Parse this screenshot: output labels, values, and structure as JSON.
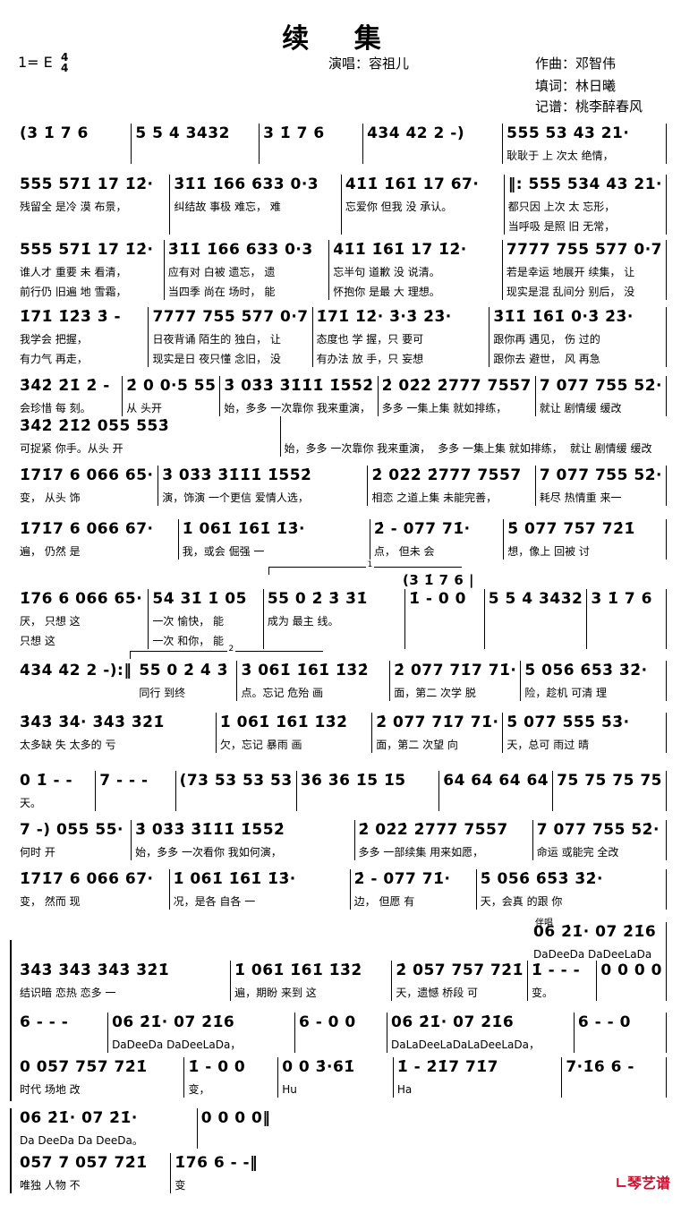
{
  "header": {
    "title": "续  集",
    "key": "1= E",
    "time_signature": {
      "top": "4",
      "bottom": "4"
    },
    "singer": "演唱：容祖儿",
    "composer": "作曲：邓智伟",
    "lyricist": "填词：林日曦",
    "transcriber": "记谱：桃李醉春风"
  },
  "volta_labels": [
    "1",
    "2"
  ],
  "accompaniment_label": "伴唱",
  "logo_text": "琴艺谱",
  "logo_color": "#c8102e",
  "systems": [
    {
      "measures": [
        {
          "notes": "(3 1̇ 7 6",
          "lyrics": []
        },
        {
          "notes": "5 5 4 3432",
          "lyrics": []
        },
        {
          "notes": "3 1̇ 7 6",
          "lyrics": []
        },
        {
          "notes": "434 42 2 -)",
          "lyrics": []
        },
        {
          "notes": "555 53 43 21·",
          "lyrics": [
            "耿耿于 上 次太 绝情，"
          ]
        }
      ]
    },
    {
      "measures": [
        {
          "notes": "555 571̇ 17 1̇2̇·",
          "lyrics": [
            "残留全 是冷 漠 布景，"
          ]
        },
        {
          "notes": "3̇1̇1̇ 1̇66 633 0·3",
          "lyrics": [
            "纠结故 事极 难忘， 难"
          ]
        },
        {
          "notes": "41̇1̇ 1̇61̇ 17 67·",
          "lyrics": [
            "忘爱你 但我 没 承认。"
          ]
        },
        {
          "notes": "‖: 555 534 43 21·",
          "lyrics": [
            "都只因 上次 太 忘形，",
            "当呼吸 是照 旧 无常，"
          ]
        }
      ]
    },
    {
      "measures": [
        {
          "notes": "555 571̇ 17 1̇2̇·",
          "lyrics": [
            "谁人才 重要 未 看清，",
            "前行仍 旧遍 地 雪霜，"
          ]
        },
        {
          "notes": "3̇1̇1̇ 1̇66 633 0·3",
          "lyrics": [
            "应有对 白被 遗忘， 遗",
            "当四季 尚在 场时， 能"
          ]
        },
        {
          "notes": "41̇1̇ 1̇61̇ 17 1̇2̇·",
          "lyrics": [
            "忘半句 道歉 没 说清。",
            "怀抱你 是最 大 理想。"
          ]
        },
        {
          "notes": "7777 755 577 0·7",
          "lyrics": [
            "若是幸运 地展开 续集， 让",
            "现实是混 乱间分 别后， 没"
          ]
        }
      ]
    },
    {
      "measures": [
        {
          "notes": "1̇71̇ 1̇2̇3̇ 3̇ -",
          "lyrics": [
            "我学会 把握，",
            "有力气 再走，"
          ]
        },
        {
          "notes": "7777 755 577 0·7",
          "lyrics": [
            "日夜背诵 陌生的 独白， 让",
            "现实是日 夜只懂 念旧， 没"
          ]
        },
        {
          "notes": "1̇71̇ 1̇2̇· 3̇·3̇ 2̇3̇·",
          "lyrics": [
            "态度也 学 握，只 要可",
            "有办法 放 手，只 妄想"
          ]
        },
        {
          "notes": "3̇1̇1̇ 1̇61̇ 0·3̇ 2̇3̇·",
          "lyrics": [
            "跟你再 遇见， 伤 过的",
            "跟你去 避世， 风 再急"
          ]
        }
      ]
    },
    {
      "measures": [
        {
          "notes": "3̇4̇2̇ 2̇1̇ 2̇ -",
          "lyrics": [
            "会珍惜 每 刻。"
          ]
        },
        {
          "notes": "2̇ 0 0·5 55",
          "lyrics": [
            "从 头开"
          ]
        },
        {
          "notes": "3̇ 03̇3̇ 3̇1̇1̇1̇ 1̇552̇",
          "lyrics": [
            "始，多多 一次靠你 我来重演，"
          ]
        },
        {
          "notes": "2̇ 02̇2̇ 2̇777 7557",
          "lyrics": [
            "多多 一集上集 就如排练，"
          ]
        },
        {
          "notes": "7 077 755 52̇·",
          "lyrics": [
            "就让 剧情缓 缓改"
          ]
        }
      ]
    },
    {
      "measures": [
        {
          "notes": "3̇4̇2̇ 2̇1̇2̇ 055 553̇",
          "lyrics": [
            "可捉紧 你手。从头 开"
          ]
        },
        {
          "notes": "",
          "lyrics": [
            "始，多多 一次靠你 我来重演，"
          ]
        },
        {
          "notes": "",
          "lyrics": [
            "多多 一集上集 就如排练，"
          ]
        },
        {
          "notes": "",
          "lyrics": [
            "就让 剧情缓 缓改"
          ]
        }
      ]
    },
    {
      "measures": [
        {
          "notes": "1̇71̇7 6 066 65·",
          "lyrics": [
            "变， 从头 饰"
          ]
        },
        {
          "notes": "3̇ 03̇3̇ 3̇1̇1̇1̇ 1̇552̇",
          "lyrics": [
            "演，饰演 一个更信 爱情人选，"
          ]
        },
        {
          "notes": "2̇ 02̇2̇ 2̇777 7557",
          "lyrics": [
            "相恋 之道上集 未能完善，"
          ]
        },
        {
          "notes": "7 077 755 52̇·",
          "lyrics": [
            "耗尽 热情重 来一"
          ]
        }
      ]
    },
    {
      "measures": [
        {
          "notes": "1̇71̇7 6 066 67·",
          "lyrics": [
            "遍， 仍然 是"
          ]
        },
        {
          "notes": "1̇ 061̇ 1̇61̇ 1̇3̇·",
          "lyrics": [
            "我，或会 倔强 一"
          ]
        },
        {
          "notes": "2̇ - 077 71̇·",
          "lyrics": [
            "点， 但未 会"
          ]
        },
        {
          "notes": "5̇ 077 757 72̇1̇",
          "lyrics": [
            "想，像上 回被 讨"
          ]
        }
      ]
    },
    {
      "measures": [
        {
          "notes": "1̇76 6 066 65·",
          "lyrics": [
            "厌， 只想 这",
            "  只想 这"
          ]
        },
        {
          "notes": "54 31̇ 1̇ 05",
          "lyrics": [
            "一次 愉快， 能",
            "一次 和你， 能"
          ]
        },
        {
          "notes": "55 0 2̇ 3̇ 3̇1̇",
          "lyrics": [
            "成为 最主 线。"
          ]
        },
        {
          "notes": "1̇ - 0 0",
          "lyrics": []
        },
        {
          "notes": "5 5 4 3432",
          "lyrics": []
        },
        {
          "notes": "3 1̇ 7 6",
          "lyrics": []
        }
      ]
    },
    {
      "measures": [
        {
          "notes": "434 42 2 -):‖",
          "lyrics": []
        },
        {
          "notes": "55 0 2̇ 4̇ 3̇",
          "lyrics": [
            "同行 到终"
          ]
        },
        {
          "notes": "3̇ 061̇ 1̇61̇ 1̇3̇2̇",
          "lyrics": [
            "点。忘记 危殆 画"
          ]
        },
        {
          "notes": "2̇ 077 71̇7 71̇·",
          "lyrics": [
            "面，第二 次学 脱"
          ]
        },
        {
          "notes": "5̇ 056̇ 6̇53̇ 3̇2̇·",
          "lyrics": [
            "险，趁机 可清 理"
          ]
        }
      ]
    },
    {
      "measures": [
        {
          "notes": "3̇4̇3̇ 3̇4̇· 3̇4̇3̇ 3̇2̇1̇",
          "lyrics": [
            "太多缺 失 太多的 亏"
          ]
        },
        {
          "notes": "1̇ 061̇ 1̇61̇ 1̇3̇2̇",
          "lyrics": [
            "欠，忘记 暴雨 画"
          ]
        },
        {
          "notes": "2̇ 077 71̇7 71̇·",
          "lyrics": [
            "面，第二 次望 向"
          ]
        },
        {
          "notes": "5̇ 07̇7̇ 5̇5̇5̇ 5̇3̇·",
          "lyrics": [
            "天，总可 雨过 晴"
          ]
        }
      ]
    },
    {
      "measures": [
        {
          "notes": "0 1̇ - -",
          "lyrics": [
            "  天。"
          ]
        },
        {
          "notes": "7 - - -",
          "lyrics": []
        },
        {
          "notes": "(73 53 53 53",
          "lyrics": []
        },
        {
          "notes": "3̇6 3̇6 1̇5 1̇5",
          "lyrics": []
        },
        {
          "notes": "64 64 64 64",
          "lyrics": []
        },
        {
          "notes": "75 75 75 75",
          "lyrics": []
        }
      ]
    },
    {
      "measures": [
        {
          "notes": "7 -) 055 55·",
          "lyrics": [
            "何时 开"
          ]
        },
        {
          "notes": "3̇ 03̇3̇ 3̇1̇1̇1̇ 1̇552̇",
          "lyrics": [
            "始，多多 一次看你 我如何演，"
          ]
        },
        {
          "notes": "2̇ 02̇2̇ 2̇777 7557",
          "lyrics": [
            "多多 一部续集 用来如愿，"
          ]
        },
        {
          "notes": "7 077 755 52̇·",
          "lyrics": [
            "命运 或能完 全改"
          ]
        }
      ]
    },
    {
      "measures": [
        {
          "notes": "1̇71̇7 6 066 67·",
          "lyrics": [
            "变， 然而 现"
          ]
        },
        {
          "notes": "1̇ 061̇ 1̇61̇ 1̇3̇·",
          "lyrics": [
            "况，是各 自各 一"
          ]
        },
        {
          "notes": "2̇ - 077 71̇·",
          "lyrics": [
            "边， 但愿 有"
          ]
        },
        {
          "notes": "5̇ 056̇ 6̇5̇3̇ 3̇2̇·",
          "lyrics": [
            "天，会真 的跟 你"
          ]
        }
      ]
    },
    {
      "measures": [
        {
          "notes": "06 2̇1̇· 07 2̇1̇6",
          "lyrics": [
            "DaDeeDa  DaDeeLaDa"
          ]
        }
      ]
    },
    {
      "measures": [
        {
          "notes": "3̇4̇3̇ 3̇4̇3̇ 3̇4̇3̇ 3̇2̇1̇",
          "lyrics": [
            "结识暗 恋热 恋多 一"
          ]
        },
        {
          "notes": "1̇ 061̇ 1̇61̇ 1̇3̇2̇",
          "lyrics": [
            "遍，期盼 来到 这"
          ]
        },
        {
          "notes": "2̇ 057 757 72̇1̇",
          "lyrics": [
            "天，遗憾 桥段 可"
          ]
        },
        {
          "notes": "1̇ - - -",
          "lyrics": [
            "变。"
          ]
        },
        {
          "notes": "0 0 0 0",
          "lyrics": []
        }
      ]
    },
    {
      "measures": [
        {
          "notes": "6 - - -",
          "lyrics": []
        },
        {
          "notes": "06 2̇1̇· 07 2̇1̇6",
          "lyrics": [
            "DaDeeDa DaDeeLaDa，"
          ]
        },
        {
          "notes": "6 - 0 0",
          "lyrics": []
        },
        {
          "notes": "06 2̇1̇· 07 2̇1̇6",
          "lyrics": [
            "DaLaDeeLaDaLaDeeLaDa，"
          ]
        },
        {
          "notes": "6 - - 0",
          "lyrics": []
        }
      ]
    },
    {
      "measures": [
        {
          "notes": "0 057 757 72̇1̇",
          "lyrics": [
            "  时代 场地 改"
          ]
        },
        {
          "notes": "1̇ - 0 0",
          "lyrics": [
            "变，"
          ]
        },
        {
          "notes": "0 0 3̇·61̇",
          "lyrics": [
            "    Hu"
          ]
        },
        {
          "notes": "1̇ - 2̇1̇7 71̇7",
          "lyrics": [
            "        Ha"
          ]
        },
        {
          "notes": "7·1̇6 6 -",
          "lyrics": []
        }
      ]
    },
    {
      "measures": [
        {
          "notes": "06 2̇1̇· 07 2̇1̇·",
          "lyrics": [
            "Da DeeDa  Da DeeDa。"
          ]
        },
        {
          "notes": "0 0 0 0‖",
          "lyrics": []
        }
      ]
    },
    {
      "measures": [
        {
          "notes": "057 7 057 72̇1̇",
          "lyrics": [
            "唯独  人物 不"
          ]
        },
        {
          "notes": "1̇76 6 - -‖",
          "lyrics": [
            "变"
          ]
        }
      ]
    }
  ]
}
